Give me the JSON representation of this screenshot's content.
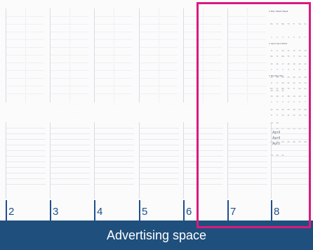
{
  "ad": {
    "label": "Advertising space"
  },
  "days": [
    "2",
    "3",
    "4",
    "5",
    "6",
    "7",
    "8"
  ],
  "months": [
    {
      "title": "1 Mon Week Week"
    },
    {
      "title": "1 April April 2024"
    },
    {
      "title": "1 Mo May Mai"
    }
  ],
  "apr_lines": [
    "April",
    "April",
    "Avril"
  ]
}
